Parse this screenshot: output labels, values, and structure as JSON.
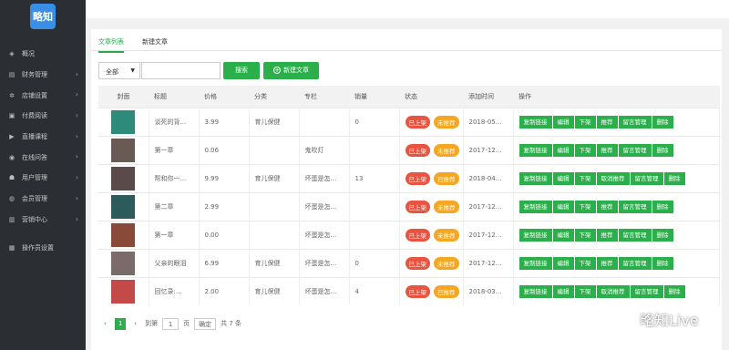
{
  "app": {
    "logo_text": "略知"
  },
  "sidebar": {
    "items": [
      {
        "label": "概况",
        "icon": "layers-icon",
        "arrow": false
      },
      {
        "label": "财务管理",
        "icon": "wallet-icon",
        "arrow": true
      },
      {
        "label": "店铺设置",
        "icon": "gear-icon",
        "arrow": true
      },
      {
        "label": "付费阅读",
        "icon": "book-icon",
        "arrow": true
      },
      {
        "label": "直播课程",
        "icon": "video-icon",
        "arrow": true
      },
      {
        "label": "在线问答",
        "icon": "location-icon",
        "arrow": true
      },
      {
        "label": "用户管理",
        "icon": "user-icon",
        "arrow": true
      },
      {
        "label": "会员管理",
        "icon": "member-icon",
        "arrow": true
      },
      {
        "label": "营销中心",
        "icon": "chart-icon",
        "arrow": true
      },
      {
        "label": "操作员设置",
        "icon": "operator-icon",
        "arrow": false
      }
    ]
  },
  "tabs": [
    {
      "label": "文章列表",
      "active": true
    },
    {
      "label": "新建文章",
      "active": false
    }
  ],
  "toolbar": {
    "filter_value": "全部",
    "search_placeholder": "",
    "search_label": "搜索",
    "new_label": "新建文章"
  },
  "table": {
    "headers": [
      "封面",
      "标题",
      "价格",
      "分类",
      "专栏",
      "销量",
      "状态",
      "添加时间",
      "操作"
    ],
    "rows": [
      {
        "cover_color": "#2e8a7a",
        "title": "谈死的背...",
        "price": "3.99",
        "category": "育儿保健",
        "column": "",
        "sales": "0",
        "status": "已上架",
        "rec": "未推荐",
        "rec_color": "#f5a623",
        "date": "2018-05...",
        "ops": [
          "复制链接",
          "编辑",
          "下架",
          "推荐",
          "留言管理",
          "删除"
        ]
      },
      {
        "cover_color": "#6a5a55",
        "title": "第一章",
        "price": "0.06",
        "category": "",
        "column": "鬼吹灯",
        "sales": "",
        "status": "已上架",
        "rec": "未推荐",
        "rec_color": "#f5a623",
        "date": "2017-12...",
        "ops": [
          "复制链接",
          "编辑",
          "下架",
          "推荐",
          "留言管理",
          "删除"
        ]
      },
      {
        "cover_color": "#5a4a4a",
        "title": "帮和你一...",
        "price": "9.99",
        "category": "育儿保健",
        "column": "坏蛋是怎...",
        "sales": "13",
        "status": "已上架",
        "rec": "已推荐",
        "rec_color": "#f5a623",
        "date": "2018-04...",
        "ops": [
          "复制链接",
          "编辑",
          "下架",
          "取消推荐",
          "留言管理",
          "删除"
        ]
      },
      {
        "cover_color": "#2d5a5a",
        "title": "第二章",
        "price": "2.99",
        "category": "",
        "column": "坏蛋是怎...",
        "sales": "",
        "status": "已上架",
        "rec": "未推荐",
        "rec_color": "#f5a623",
        "date": "2017-12...",
        "ops": [
          "复制链接",
          "编辑",
          "下架",
          "推荐",
          "留言管理",
          "删除"
        ]
      },
      {
        "cover_color": "#8a4a3a",
        "title": "第一章",
        "price": "0.00",
        "category": "",
        "column": "坏蛋是怎...",
        "sales": "",
        "status": "已上架",
        "rec": "未推荐",
        "rec_color": "#f5a623",
        "date": "2017-12...",
        "ops": [
          "复制链接",
          "编辑",
          "下架",
          "推荐",
          "留言管理",
          "删除"
        ]
      },
      {
        "cover_color": "#7a6a6a",
        "title": "父亲的眼泪",
        "price": "6.99",
        "category": "育儿保健",
        "column": "坏蛋是怎...",
        "sales": "0",
        "status": "已上架",
        "rec": "未推荐",
        "rec_color": "#f5a623",
        "date": "2017-12...",
        "ops": [
          "复制链接",
          "编辑",
          "下架",
          "推荐",
          "留言管理",
          "删除"
        ]
      },
      {
        "cover_color": "#c44a4a",
        "title": "回忆录:...",
        "price": "2.00",
        "category": "育儿保健",
        "column": "坏蛋是怎...",
        "sales": "4",
        "status": "已上架",
        "rec": "已推荐",
        "rec_color": "#f5a623",
        "date": "2018-03...",
        "ops": [
          "复制链接",
          "编辑",
          "下架",
          "取消推荐",
          "留言管理",
          "删除"
        ]
      }
    ]
  },
  "pagination": {
    "prev": "‹",
    "current": "1",
    "next": "›",
    "goto_label": "到第",
    "input_value": "1",
    "page_unit": "页",
    "confirm_label": "确定",
    "total": "共 7 条"
  },
  "watermark": {
    "text": "略知Live"
  },
  "colors": {
    "accent": "#2aaf4a",
    "status_red": "#e8543f",
    "rec_orange": "#f5a623",
    "sidebar_bg": "#2b2e33"
  }
}
